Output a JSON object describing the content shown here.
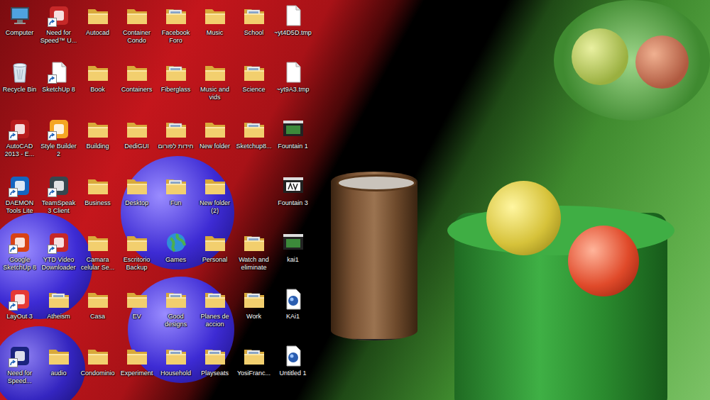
{
  "desktop": {
    "icons": [
      {
        "label": "Computer",
        "kind": "computer",
        "shortcut": false
      },
      {
        "label": "Recycle Bin",
        "kind": "recycle",
        "shortcut": false
      },
      {
        "label": "AutoCAD 2013 - E...",
        "kind": "app",
        "shortcut": true,
        "color": "#b71c1c"
      },
      {
        "label": "DAEMON Tools Lite",
        "kind": "app",
        "shortcut": true,
        "color": "#1565c0"
      },
      {
        "label": "Google SketchUp 8",
        "kind": "app",
        "shortcut": true,
        "color": "#d84315"
      },
      {
        "label": "LayOut 3",
        "kind": "app",
        "shortcut": true,
        "color": "#e53935"
      },
      {
        "label": "Need for Speed...",
        "kind": "app",
        "shortcut": true,
        "color": "#1a237e"
      },
      {
        "label": "Need for Speed™ U...",
        "kind": "app",
        "shortcut": true,
        "color": "#c62828"
      },
      {
        "label": "SketchUp 8",
        "kind": "file",
        "shortcut": true
      },
      {
        "label": "Style Builder 2",
        "kind": "app",
        "shortcut": true,
        "color": "#f5a623"
      },
      {
        "label": "TeamSpeak 3 Client",
        "kind": "app",
        "shortcut": true,
        "color": "#37474f"
      },
      {
        "label": "YTD Video Downloader",
        "kind": "app",
        "shortcut": true,
        "color": "#c62828"
      },
      {
        "label": "Atheism",
        "kind": "folder-doc",
        "shortcut": false
      },
      {
        "label": "audio",
        "kind": "folder",
        "shortcut": false
      },
      {
        "label": "Autocad",
        "kind": "folder",
        "shortcut": false
      },
      {
        "label": "Book",
        "kind": "folder",
        "shortcut": false
      },
      {
        "label": "Building",
        "kind": "folder",
        "shortcut": false
      },
      {
        "label": "Business",
        "kind": "folder",
        "shortcut": false
      },
      {
        "label": "Camara celular Se...",
        "kind": "folder",
        "shortcut": false
      },
      {
        "label": "Casa",
        "kind": "folder",
        "shortcut": false
      },
      {
        "label": "Condominio",
        "kind": "folder",
        "shortcut": false
      },
      {
        "label": "Container Condo",
        "kind": "folder",
        "shortcut": false
      },
      {
        "label": "Containers",
        "kind": "folder",
        "shortcut": false
      },
      {
        "label": "DediGUI",
        "kind": "folder",
        "shortcut": false
      },
      {
        "label": "Desktop",
        "kind": "folder",
        "shortcut": false
      },
      {
        "label": "Escritorio Backup",
        "kind": "folder",
        "shortcut": false
      },
      {
        "label": "EV",
        "kind": "folder",
        "shortcut": false
      },
      {
        "label": "Experiment",
        "kind": "folder",
        "shortcut": false
      },
      {
        "label": "Facebook Foro",
        "kind": "folder-doc",
        "shortcut": false
      },
      {
        "label": "Fiberglass",
        "kind": "folder-doc",
        "shortcut": false
      },
      {
        "label": "חידות לפורום",
        "kind": "folder-doc",
        "shortcut": false
      },
      {
        "label": "Fun",
        "kind": "folder-doc",
        "shortcut": false
      },
      {
        "label": "Games",
        "kind": "games",
        "shortcut": false
      },
      {
        "label": "Good designs",
        "kind": "folder-doc",
        "shortcut": false
      },
      {
        "label": "Household",
        "kind": "folder-doc",
        "shortcut": false
      },
      {
        "label": "Music",
        "kind": "folder",
        "shortcut": false
      },
      {
        "label": "Music and vids",
        "kind": "folder",
        "shortcut": false
      },
      {
        "label": "New folder",
        "kind": "folder",
        "shortcut": false
      },
      {
        "label": "New folder (2)",
        "kind": "folder",
        "shortcut": false
      },
      {
        "label": "Personal",
        "kind": "folder",
        "shortcut": false
      },
      {
        "label": "Planes de accion",
        "kind": "folder-doc",
        "shortcut": false
      },
      {
        "label": "Playseats",
        "kind": "folder-doc",
        "shortcut": false
      },
      {
        "label": "School",
        "kind": "folder-doc",
        "shortcut": false
      },
      {
        "label": "Science",
        "kind": "folder-doc",
        "shortcut": false
      },
      {
        "label": "Sketchup8...",
        "kind": "folder-doc",
        "shortcut": false
      },
      {
        "label": "Watch and eliminate",
        "kind": "folder-doc",
        "shortcut": false
      },
      {
        "label": "Work",
        "kind": "folder-doc",
        "shortcut": false
      },
      {
        "label": "YosiFranc...",
        "kind": "folder-doc",
        "shortcut": false
      },
      {
        "label": "~yt4D5D.tmp",
        "kind": "file",
        "shortcut": false
      },
      {
        "label": "~yt9A3.tmp",
        "kind": "file",
        "shortcut": false
      },
      {
        "label": "Fountain 1",
        "kind": "video",
        "shortcut": false
      },
      {
        "label": "Fountain 3",
        "kind": "avi",
        "shortcut": false
      },
      {
        "label": "kai1",
        "kind": "video",
        "shortcut": false
      },
      {
        "label": "KAi1",
        "kind": "media",
        "shortcut": false
      },
      {
        "label": "Untitled 1",
        "kind": "media",
        "shortcut": false
      }
    ]
  }
}
